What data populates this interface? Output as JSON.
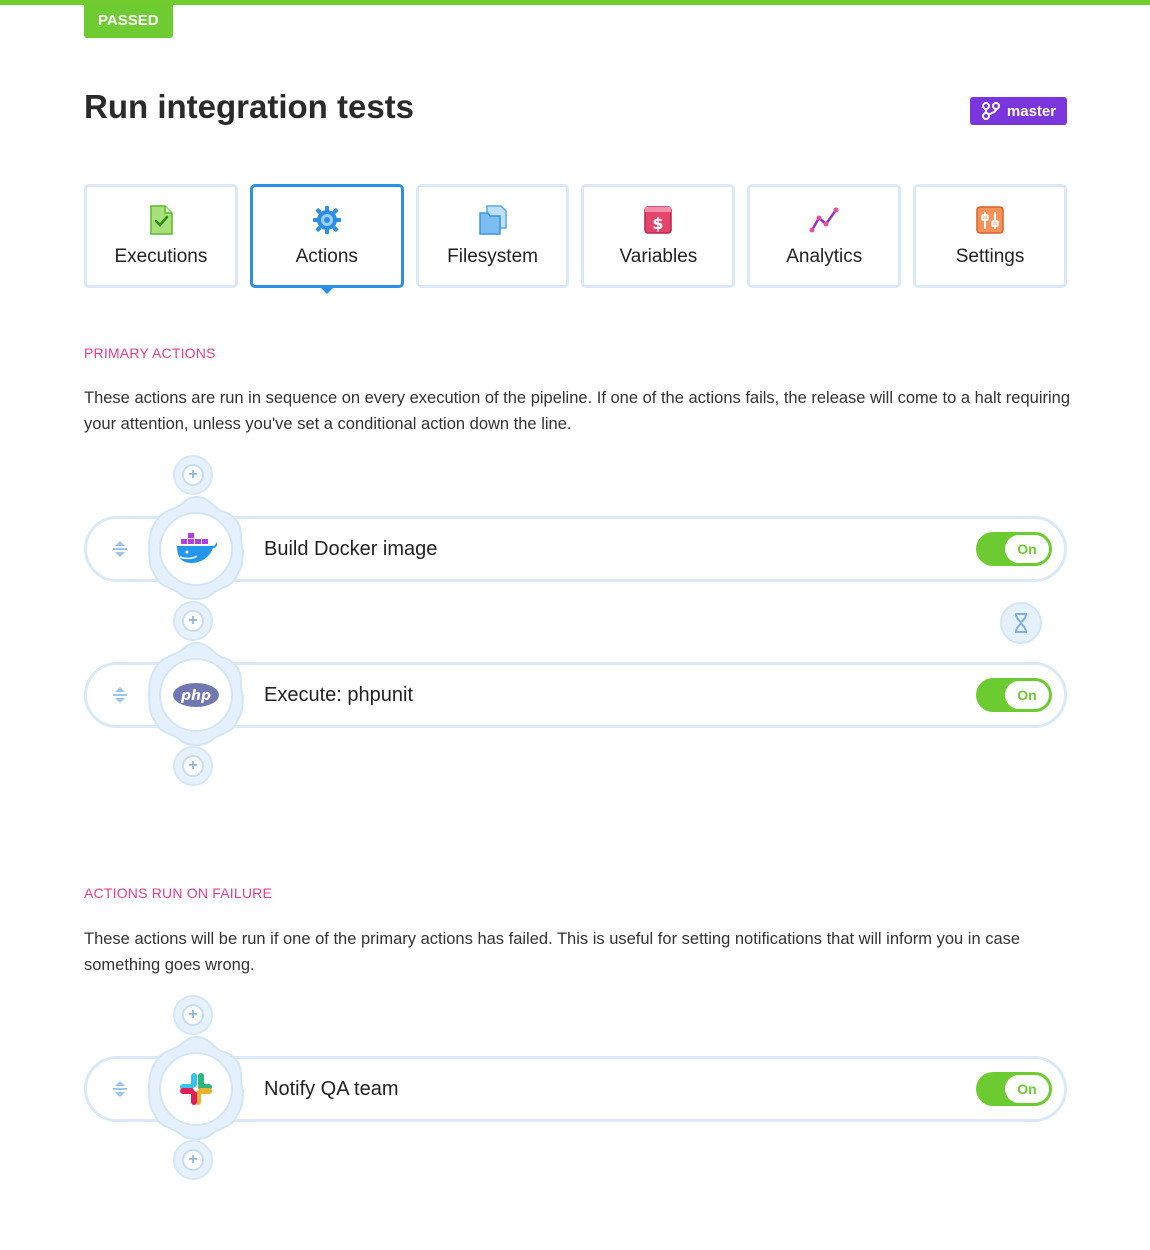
{
  "status": {
    "label": "PASSED",
    "color": "#6fcb32"
  },
  "page": {
    "title": "Run integration tests"
  },
  "branch": {
    "label": "master",
    "icon": "branch-icon",
    "color": "#7a35dc"
  },
  "tabs": [
    {
      "label": "Executions",
      "icon": "executions-icon",
      "active": false
    },
    {
      "label": "Actions",
      "icon": "actions-gear-icon",
      "active": true
    },
    {
      "label": "Filesystem",
      "icon": "filesystem-icon",
      "active": false
    },
    {
      "label": "Variables",
      "icon": "variables-icon",
      "active": false
    },
    {
      "label": "Analytics",
      "icon": "analytics-icon",
      "active": false
    },
    {
      "label": "Settings",
      "icon": "settings-icon",
      "active": false
    }
  ],
  "primary": {
    "heading": "PRIMARY ACTIONS",
    "description": "These actions are run in sequence on every execution of the pipeline. If one of the actions fails, the release will come to a halt requiring your attention, unless you've set a conditional action down the line.",
    "actions": [
      {
        "name": "Build Docker image",
        "icon": "docker-icon",
        "toggle": "On"
      },
      {
        "name": "Execute: phpunit",
        "icon": "php-icon",
        "toggle": "On"
      }
    ]
  },
  "failure": {
    "heading": "ACTIONS RUN ON FAILURE",
    "description": "These actions will be run if one of the primary actions has failed. This is useful for setting notifications that will inform you in case something goes wrong.",
    "actions": [
      {
        "name": "Notify QA team",
        "icon": "slack-icon",
        "toggle": "On"
      }
    ]
  },
  "colors": {
    "accent": "#2b8fe6",
    "heading": "#e43e8c",
    "toggle_on": "#6dcb32"
  }
}
